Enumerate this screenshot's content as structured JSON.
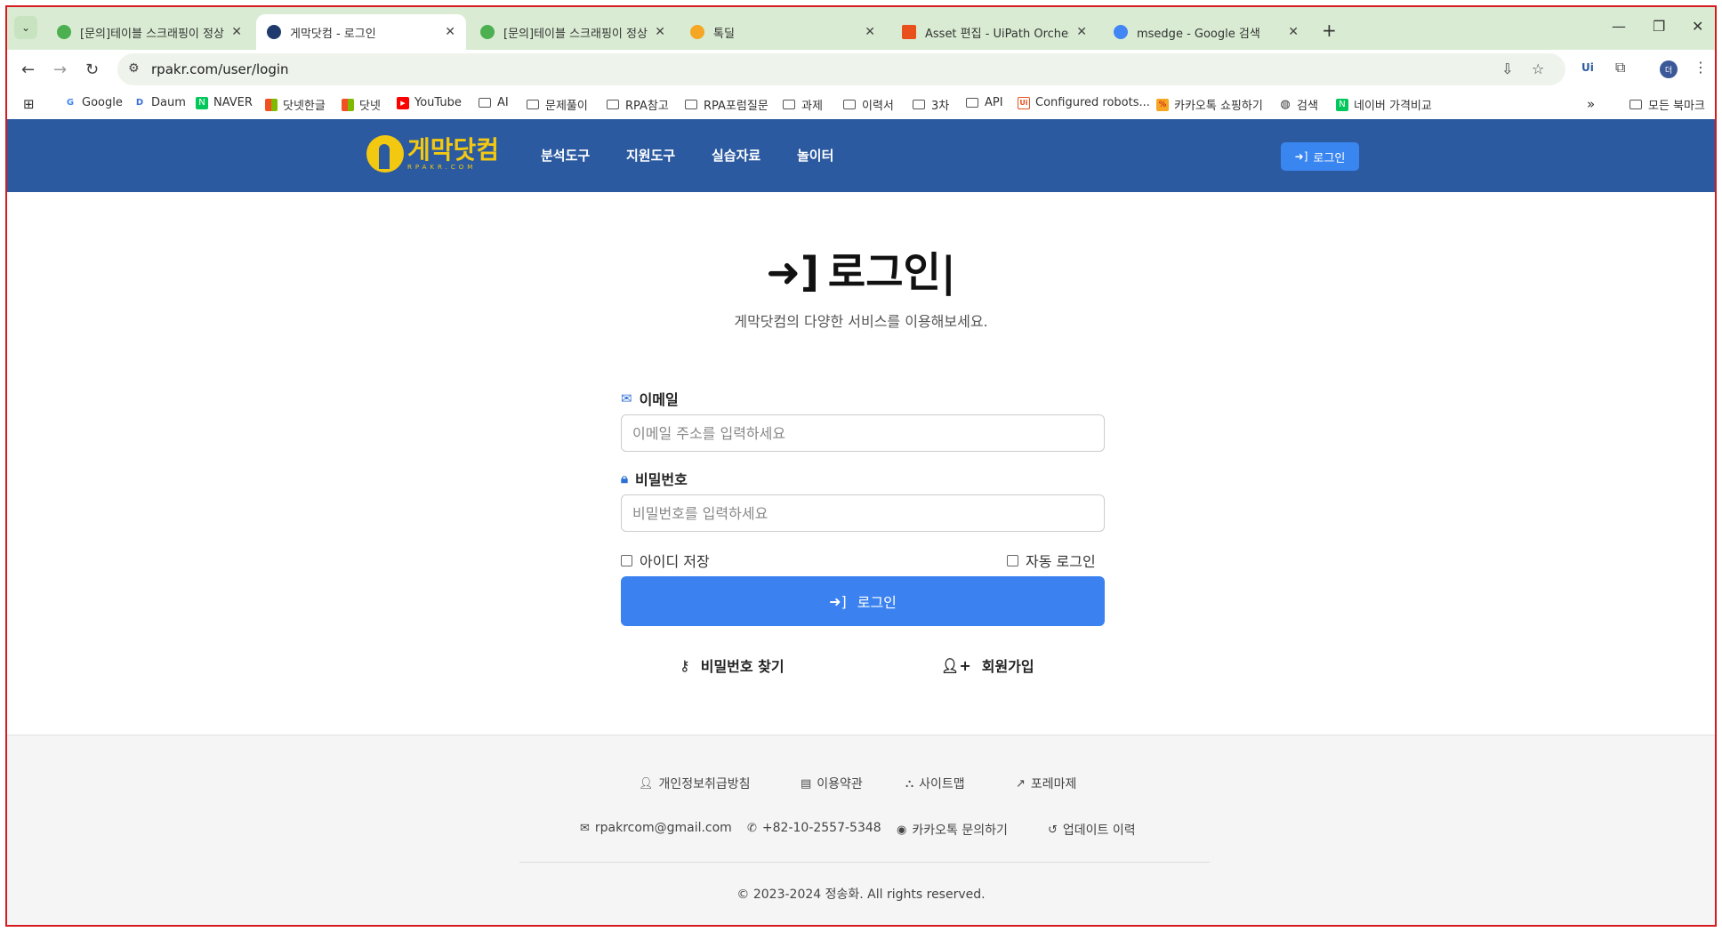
{
  "browser": {
    "tabs": [
      {
        "title": "[문의]테이블 스크래핑이 정상적",
        "favicon_color": "#4caf50",
        "active": false
      },
      {
        "title": "게막닷컴 - 로그인",
        "favicon_color": "#1f3b6e",
        "active": true
      },
      {
        "title": "[문의]테이블 스크래핑이 정상적",
        "favicon_color": "#4caf50",
        "active": false
      },
      {
        "title": "톡딜",
        "favicon_color": "#f5a623",
        "active": false
      },
      {
        "title": "Asset 편집 - UiPath Orchestrat",
        "favicon_color": "#e8501c",
        "active": false
      },
      {
        "title": "msedge - Google 검색",
        "favicon_color": "#4285f4",
        "active": false
      }
    ],
    "url": "rpakr.com/user/login",
    "profile_initial": "더",
    "bookmarks": [
      {
        "label": "Google",
        "icon": "google-icon"
      },
      {
        "label": "Daum",
        "icon": "daum-icon"
      },
      {
        "label": "NAVER",
        "icon": "naver-icon"
      },
      {
        "label": "닷넷한글",
        "icon": "windows-icon"
      },
      {
        "label": "닷넷",
        "icon": "windows-icon"
      },
      {
        "label": "YouTube",
        "icon": "youtube-icon"
      },
      {
        "label": "AI",
        "icon": "folder-icon"
      },
      {
        "label": "문제풀이",
        "icon": "folder-icon"
      },
      {
        "label": "RPA참고",
        "icon": "folder-icon"
      },
      {
        "label": "RPA포럼질문",
        "icon": "folder-icon"
      },
      {
        "label": "과제",
        "icon": "folder-icon"
      },
      {
        "label": "이력서",
        "icon": "folder-icon"
      },
      {
        "label": "3차",
        "icon": "folder-icon"
      },
      {
        "label": "API",
        "icon": "folder-icon"
      },
      {
        "label": "Configured robots...",
        "icon": "uipath-icon"
      },
      {
        "label": "카카오톡 쇼핑하기",
        "icon": "kakao-icon"
      },
      {
        "label": "검색",
        "icon": "globe-icon"
      },
      {
        "label": "네이버 가격비교",
        "icon": "naver-icon"
      }
    ],
    "all_bookmarks": "모든 북마크"
  },
  "site": {
    "logo_text": "게막닷컴",
    "logo_sub": "RPAKR.COM",
    "nav": [
      "분석도구",
      "지원도구",
      "실습자료",
      "놀이터"
    ],
    "header_login": "로그인",
    "brand_color": "#2c5aa0",
    "accent_color": "#3b82f0"
  },
  "login": {
    "title": "로그인|",
    "subtitle": "게막닷컴의 다양한 서비스를 이용해보세요.",
    "email_label": "이메일",
    "email_placeholder": "이메일 주소를 입력하세요",
    "password_label": "비밀번호",
    "password_placeholder": "비밀번호를 입력하세요",
    "remember_id": "아이디 저장",
    "auto_login": "자동 로그인",
    "submit": "로그인",
    "find_password": "비밀번호 찾기",
    "signup": "회원가입"
  },
  "footer": {
    "links": [
      "개인정보취급방침",
      "이용약관",
      "사이트맵",
      "포레마제"
    ],
    "email": "rpakrcom@gmail.com",
    "phone": "+82-10-2557-5348",
    "kakao": "카카오톡 문의하기",
    "updates": "업데이트 이력",
    "copyright": "© 2023-2024 정송화. All rights reserved."
  }
}
